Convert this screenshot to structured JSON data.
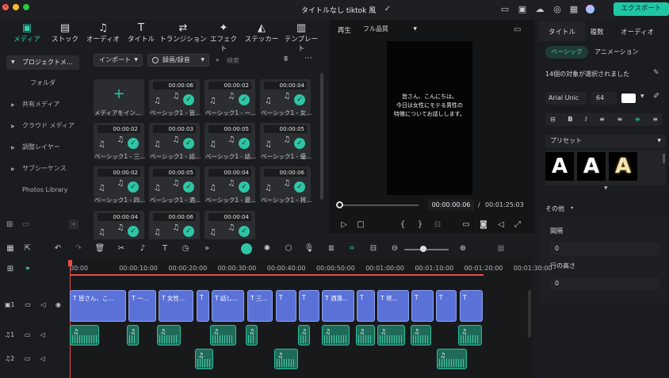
{
  "window": {
    "title": "タイトルなし tiktok 風"
  },
  "header": {
    "export_label": "エクスポート"
  },
  "top_tabs": [
    "メディア",
    "ストック",
    "オーディオ",
    "タイトル",
    "トランジション",
    "エフェクト",
    "ステッカー",
    "テンプレート"
  ],
  "sidebar": {
    "items": [
      "プロジェクトメ...",
      "フォルダ",
      "共有メディア",
      "クラウド メディア",
      "調整レイヤー",
      "サブシーケンス",
      "Photos Library"
    ]
  },
  "media": {
    "import_label": "インポート",
    "record_label": "録画/録音",
    "search_placeholder": "検索",
    "add_label": "メディアをイン...",
    "tiles": [
      {
        "dur": "00:00:06",
        "label": "ベーシック1 - 皆..."
      },
      {
        "dur": "00:00:02",
        "label": "ベーシック1 - 一..."
      },
      {
        "dur": "00:00:04",
        "label": "ベーシック1 - 女..."
      },
      {
        "dur": "00:00:02",
        "label": "ベーシック1 - 三..."
      },
      {
        "dur": "00:00:03",
        "label": "ベーシック1 - 話..."
      },
      {
        "dur": "00:00:05",
        "label": "ベーシック1 - 話..."
      },
      {
        "dur": "00:00:05",
        "label": "ベーシック1 - 優..."
      },
      {
        "dur": "00:00:02",
        "label": "ベーシック1 - 四..."
      },
      {
        "dur": "00:00:05",
        "label": "ベーシック1 - 酒..."
      },
      {
        "dur": "00:00:04",
        "label": "ベーシック1 - 最..."
      },
      {
        "dur": "00:00:06",
        "label": "ベーシック1 - 将..."
      },
      {
        "dur": "00:00:04",
        "label": ""
      },
      {
        "dur": "00:00:06",
        "label": ""
      },
      {
        "dur": "00:00:04",
        "label": ""
      }
    ]
  },
  "preview": {
    "play_label": "再生",
    "quality": "フル品質",
    "subtitle_line1": "皆さん、こんにちは。",
    "subtitle_line2": "今日は女性にモテる男性の",
    "subtitle_line3": "特徴についてお話しします。",
    "current_time": "00:00:00:06",
    "separator": "/",
    "total_time": "00:01:25:03",
    "progress": 0.0
  },
  "right_panel": {
    "tabs": [
      "タイトル",
      "複数",
      "オーディオ"
    ],
    "subtabs": [
      "ベーシック",
      "アニメーション"
    ],
    "selection_text": "14個の対象が選択されました",
    "font": "Arial Unic",
    "font_size": "64",
    "text_color": "#ffffff",
    "preset_label": "プリセット",
    "preset_letter": "A",
    "other_label": "その他",
    "spacing_label": "間隔",
    "spacing_value": "0",
    "line_height_label": "行の高さ",
    "line_height_value": "0"
  },
  "timeline": {
    "ruler": [
      "00:00",
      "00:00:10:00",
      "00:00:20:00",
      "00:00:30:00",
      "00:00:40:00",
      "00:00:50:00",
      "00:01:00:00",
      "00:01:10:00",
      "00:01:20:00",
      "00:01:30:00"
    ],
    "title_clips": [
      "皆さん、こ...",
      "一...",
      "女性...",
      "",
      "話し...",
      "三...",
      "",
      "",
      "酒落...",
      "",
      "将...",
      "",
      "",
      ""
    ],
    "title_clip_icon": "T"
  },
  "colors": {
    "accent": "#1fc7a5",
    "title_clip": "#5a72d8",
    "audio_clip": "#1f6b5a",
    "playhead": "#e84a4a"
  }
}
